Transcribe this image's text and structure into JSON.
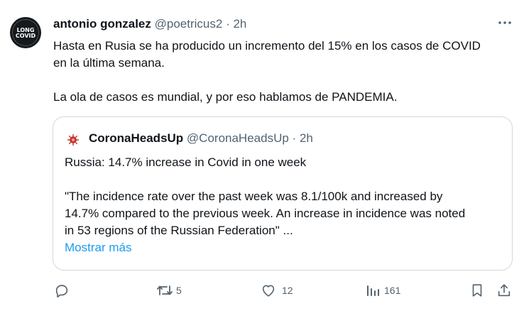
{
  "author": {
    "name": "antonio gonzalez",
    "handle": "@poetricus2",
    "separator": "·",
    "time": "2h",
    "avatar_lines": [
      "LONG",
      "COVID"
    ]
  },
  "tweet": {
    "line1": "Hasta en Rusia se ha producido un incremento del 15% en los casos de COVID",
    "line2": "en la última semana.",
    "line3": "La ola de casos es mundial, y por eso hablamos de PANDEMIA."
  },
  "quote": {
    "name": "CoronaHeadsUp",
    "handle": "@CoronaHeadsUp",
    "separator": "·",
    "time": "2h",
    "line1": "Russia: 14.7% increase in Covid in one week",
    "line2": "\"The incidence rate over the past week was 8.1/100k and increased by",
    "line3": "14.7% compared to the previous week. An increase in incidence was noted",
    "line4": "in 53 regions of the Russian Federation\" ...",
    "show_more": "Mostrar más",
    "accent_color": "#c0392b"
  },
  "actions": {
    "reply_count": "",
    "retweet_count": "5",
    "like_count": "12",
    "views_count": "161"
  },
  "icons": {
    "more": "more-icon",
    "reply": "reply-icon",
    "retweet": "retweet-icon",
    "like": "heart-icon",
    "views": "views-icon",
    "bookmark": "bookmark-icon",
    "share": "share-icon"
  },
  "colors": {
    "text": "#0f1419",
    "secondary": "#536471",
    "link": "#1d9bf0",
    "border": "#cfd9de"
  }
}
